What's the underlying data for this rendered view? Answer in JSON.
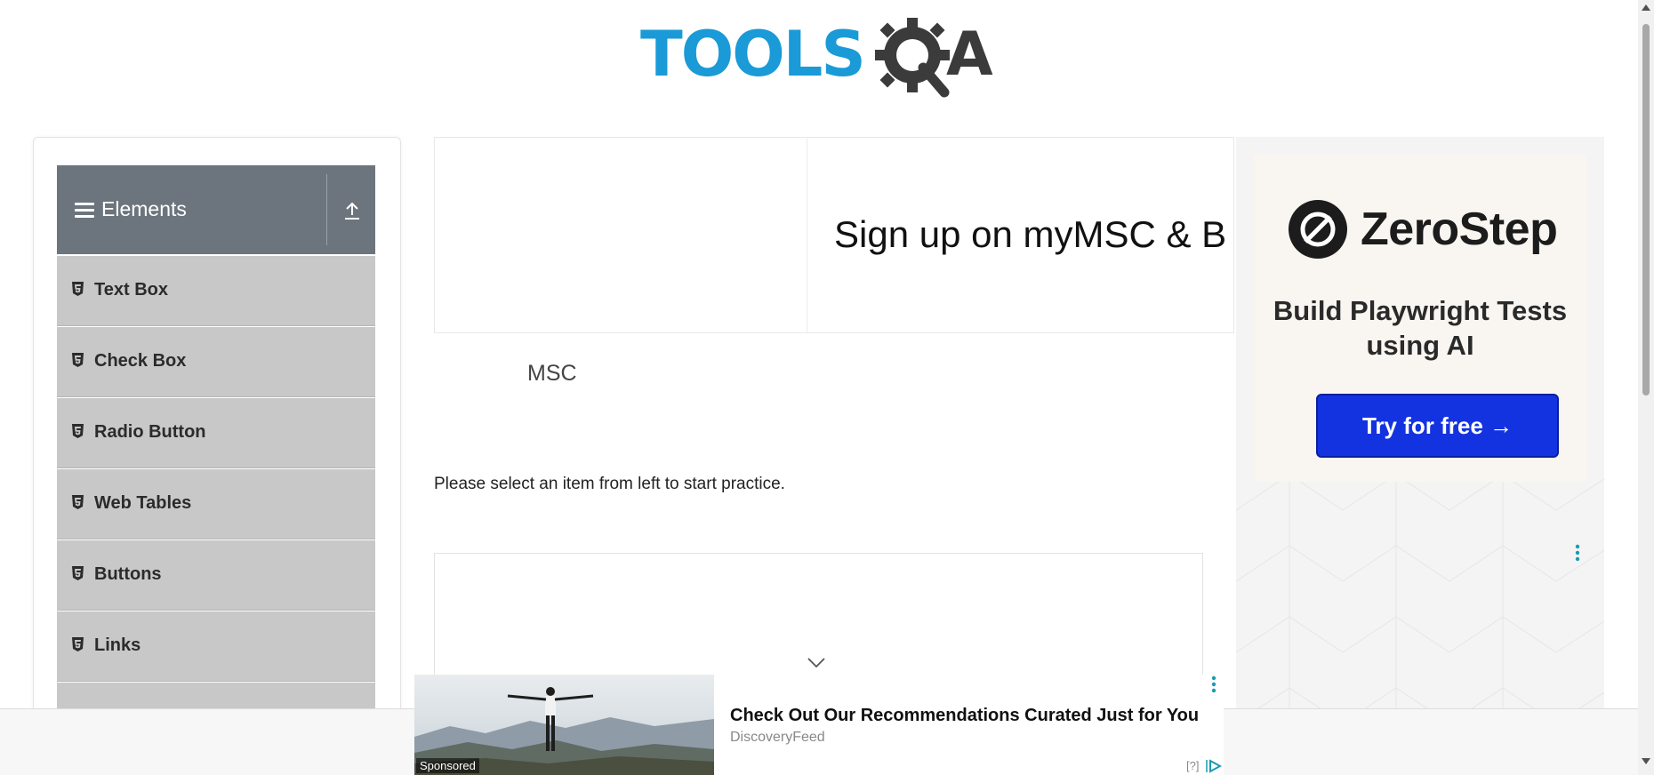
{
  "header": {
    "logo_text_left": "TOOLS",
    "logo_text_right": "A",
    "logo_icon": "gear-magnifier-icon"
  },
  "sidebar": {
    "group_title": "Elements",
    "items": [
      {
        "label": "Text Box",
        "icon": "html5-icon"
      },
      {
        "label": "Check Box",
        "icon": "html5-icon"
      },
      {
        "label": "Radio Button",
        "icon": "html5-icon"
      },
      {
        "label": "Web Tables",
        "icon": "html5-icon"
      },
      {
        "label": "Buttons",
        "icon": "html5-icon"
      },
      {
        "label": "Links",
        "icon": "html5-icon"
      }
    ]
  },
  "main": {
    "ad_headline": "Sign up on myMSC & B",
    "ad_advertiser": "MSC",
    "instructions": "Please select an item from left to start practice."
  },
  "right_ad": {
    "brand": "ZeroStep",
    "tagline": "Build Playwright Tests using AI",
    "cta": "Try for free →"
  },
  "sticky_ad": {
    "title": "Check Out Our Recommendations Curated Just for You",
    "source": "DiscoveryFeed",
    "sponsored_label": "Sponsored",
    "help": "[?]"
  },
  "colors": {
    "brand_blue": "#1a9ad6",
    "sidebar_header": "#6c757d",
    "menu_item_bg": "#c8c8c8",
    "cta_blue": "#1433e0"
  }
}
